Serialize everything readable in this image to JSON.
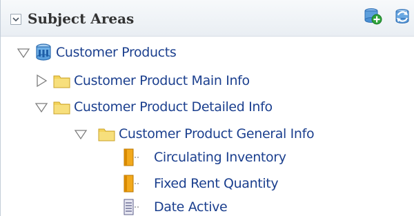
{
  "panel": {
    "title": "Subject Areas",
    "collapse_icon": "chevron-down-icon",
    "add_icon": "add-subject-area-icon",
    "refresh_icon": "refresh-icon"
  },
  "colors": {
    "label_text": "#1b3f8e",
    "header_bg": "#eef2f6",
    "folder_yellow": "#f3d35a",
    "measure_orange": "#f2a91c",
    "toggle_gray": "#7d7d7d"
  },
  "tree": {
    "root": {
      "label": "Customer Products",
      "state": "expanded",
      "icon": "subject-area-icon"
    },
    "main_info": {
      "label": "Customer Product Main Info",
      "state": "collapsed",
      "icon": "folder-icon"
    },
    "detailed_info": {
      "label": "Customer Product Detailed Info",
      "state": "expanded",
      "icon": "folder-icon"
    },
    "general_info": {
      "label": "Customer Product General Info",
      "state": "expanded",
      "icon": "folder-icon"
    },
    "circulating_inventory": {
      "label": "Circulating Inventory",
      "icon": "measure-column-icon"
    },
    "fixed_rent_quantity": {
      "label": "Fixed Rent Quantity",
      "icon": "measure-column-icon"
    },
    "date_active": {
      "label": "Date Active",
      "icon": "attribute-column-icon"
    }
  }
}
